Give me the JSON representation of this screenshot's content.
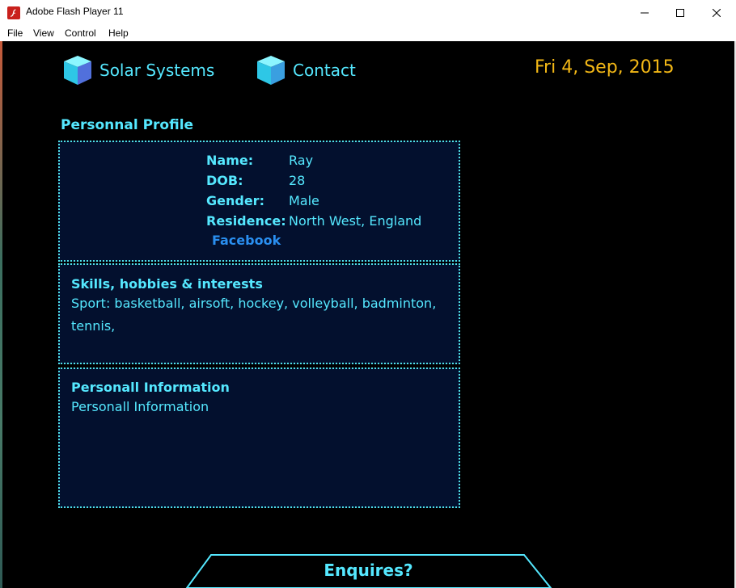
{
  "window": {
    "title": "Adobe Flash Player 11",
    "controls": {
      "minimize": "minimize",
      "maximize": "maximize",
      "close": "close"
    }
  },
  "menu": [
    "File",
    "View",
    "Control",
    "Help"
  ],
  "nav": {
    "solar_label": "Solar Systems",
    "contact_label": "Contact",
    "date": "Fri 4, Sep, 2015"
  },
  "profile": {
    "title": "Personnal Profile",
    "fields": [
      {
        "label": "Name:",
        "value": "Ray"
      },
      {
        "label": "DOB:",
        "value": "28"
      },
      {
        "label": "Gender:",
        "value": "Male"
      },
      {
        "label": "Residence:",
        "value": "North West, England"
      }
    ],
    "facebook_label": "Facebook"
  },
  "skills": {
    "heading": "Skills, hobbies & interests",
    "text": "Sport: basketball, airsoft, hockey, volleyball, badminton, tennis,"
  },
  "info": {
    "heading": "Personall Information",
    "text": "Personall Information"
  },
  "enquire_label": "Enquires?",
  "colors": {
    "accent": "#55e8ff",
    "date": "#f3b816",
    "link": "#2a8ff0",
    "panel_bg": "#03102e",
    "stage_bg": "#000000"
  },
  "icons": {
    "app": "flash-icon",
    "nav": "cube-icon"
  }
}
